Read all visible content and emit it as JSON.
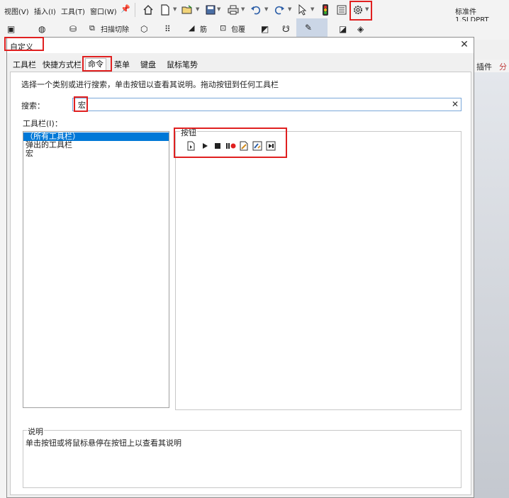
{
  "menubar": {
    "items": [
      "视图(V)",
      "插入(I)",
      "工具(T)",
      "窗口(W)"
    ],
    "filename": "标准件1.SLDPRT"
  },
  "ribbon": {
    "items": [
      "扫描切除",
      "筋",
      "包覆"
    ]
  },
  "right_panel": {
    "tabs": [
      "插件",
      "分"
    ]
  },
  "dialog": {
    "title": "自定义",
    "tabs": [
      "工具栏",
      "快捷方式栏",
      "命令",
      "菜单",
      "键盘",
      "鼠标笔势"
    ],
    "active_tab": "命令",
    "description": "选择一个类别或进行搜索，单击按钮以查看其说明。拖动按钮到任何工具栏",
    "search": {
      "label": "搜索：",
      "value": "宏"
    },
    "toolbars": {
      "label": "工具栏(I)：",
      "items": [
        "（所有工具栏）",
        "弹出的工具栏",
        "宏"
      ],
      "selected_index": 0
    },
    "buttons": {
      "label": "按钮",
      "icons": [
        "new-macro-icon",
        "run-macro-icon",
        "stop-macro-icon",
        "record-pause-macro-icon",
        "edit-macro-icon",
        "macro-button-icon",
        "new-macro-button-icon"
      ]
    },
    "explanation": {
      "label": "说明",
      "text": "单击按钮或将鼠标悬停在按钮上以查看其说明"
    }
  },
  "colors": {
    "highlight": "#e02020",
    "selection": "#0078d7",
    "search_border": "#7aa7d9"
  }
}
